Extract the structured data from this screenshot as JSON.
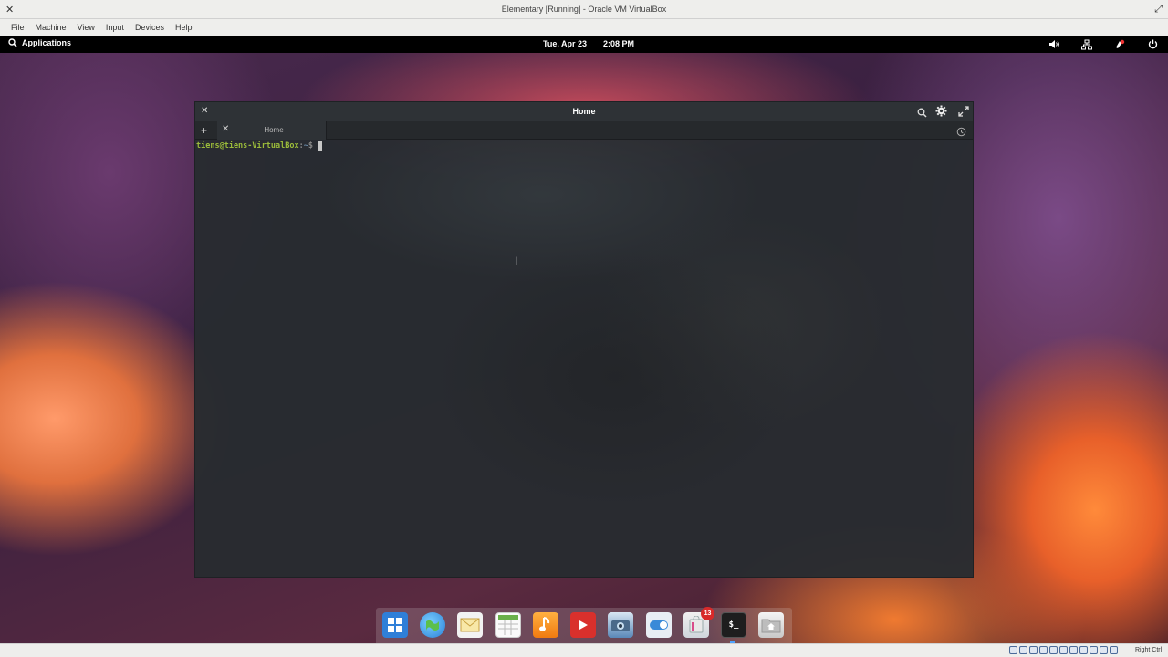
{
  "vbox": {
    "title": "Elementary [Running] - Oracle VM VirtualBox",
    "menu": [
      "File",
      "Machine",
      "View",
      "Input",
      "Devices",
      "Help"
    ],
    "host_key": "Right Ctrl"
  },
  "panel": {
    "applications": "Applications",
    "date": "Tue, Apr 23",
    "time": "2:08 PM",
    "tray": [
      "volume-icon",
      "network-icon",
      "notifications-icon",
      "power-icon"
    ]
  },
  "terminal": {
    "title": "Home",
    "tab_label": "Home",
    "prompt_user": "tiens@tiens-VirtualBox",
    "prompt_sep": ":",
    "prompt_path": "~",
    "prompt_symbol": "$"
  },
  "dock": {
    "items": [
      "multitasking-view-icon",
      "web-browser-icon",
      "mail-icon",
      "calendar-icon",
      "music-icon",
      "videos-icon",
      "photos-icon",
      "settings-switch-icon",
      "appcenter-icon",
      "terminal-icon",
      "files-icon"
    ],
    "appcenter_badge": "13",
    "terminal_label": "$_"
  },
  "colors": {
    "prompt_user": "#9bbb3a",
    "prompt_path": "#6a8aa8",
    "panel_bg": "#000000",
    "badge": "#d82a2a"
  }
}
